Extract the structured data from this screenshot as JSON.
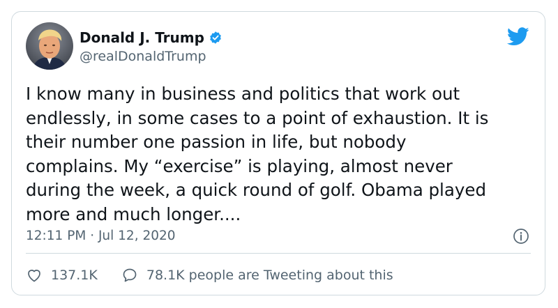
{
  "tweet": {
    "author_name": "Donald J. Trump",
    "handle": "@realDonaldTrump",
    "text": "I know many in business and politics that work out\nendlessly, in some cases to a point of exhaustion. It is\ntheir number one passion in life, but nobody\ncomplains. My “exercise” is playing, almost never\nduring the week, a quick round of golf. Obama played\nmore and much longer....",
    "timestamp": "12:11 PM · Jul 12, 2020",
    "likes": "137.1K",
    "tweeting_count": "78.1K people are Tweeting about this"
  },
  "icons": {
    "verified": "verified-badge-icon",
    "brand": "twitter-bird-icon",
    "info": "info-icon",
    "like": "heart-icon",
    "reply": "speech-bubble-icon"
  },
  "colors": {
    "brand_blue": "#1d9bf0",
    "text_primary": "#0f1419",
    "text_secondary": "#536471",
    "border": "#cfd9de"
  }
}
